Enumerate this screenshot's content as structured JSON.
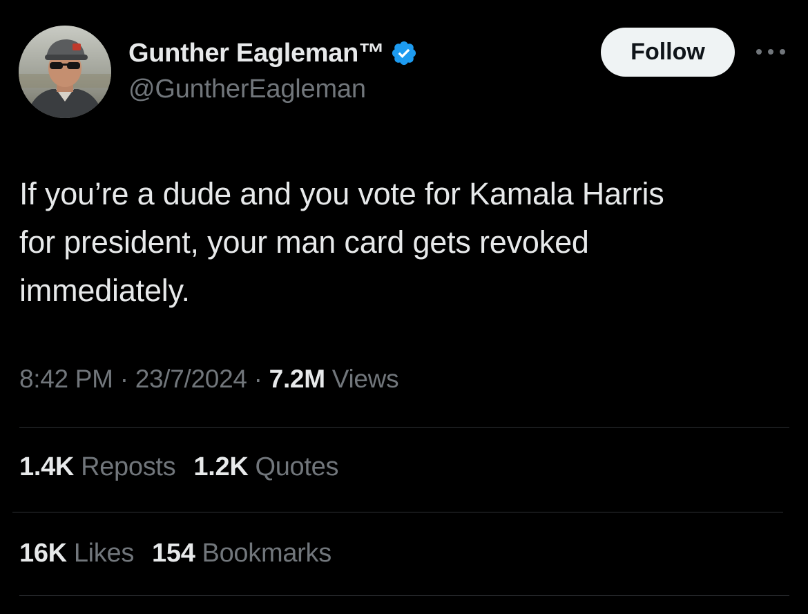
{
  "author": {
    "display_name": "Gunther Eagleman™",
    "handle": "@GuntherEagleman",
    "verified": true,
    "verified_color": "#1d9bf0"
  },
  "actions": {
    "follow_label": "Follow",
    "more_icon": "more-horizontal-icon"
  },
  "tweet": {
    "text": "If you’re a dude and you vote for Kamala Harris\nfor president, your man card gets revoked\nimmediately."
  },
  "meta": {
    "time": "8:42 PM",
    "date": "23/7/2024",
    "views_count": "7.2M",
    "views_label": "Views",
    "separator": "·"
  },
  "stats": {
    "reposts_count": "1.4K",
    "reposts_label": "Reposts",
    "quotes_count": "1.2K",
    "quotes_label": "Quotes",
    "likes_count": "16K",
    "likes_label": "Likes",
    "bookmarks_count": "154",
    "bookmarks_label": "Bookmarks"
  },
  "colors": {
    "background": "#000000",
    "primary_text": "#e7e9ea",
    "secondary_text": "#71767b",
    "divider": "#2f3336",
    "follow_button_bg": "#eff3f4"
  }
}
